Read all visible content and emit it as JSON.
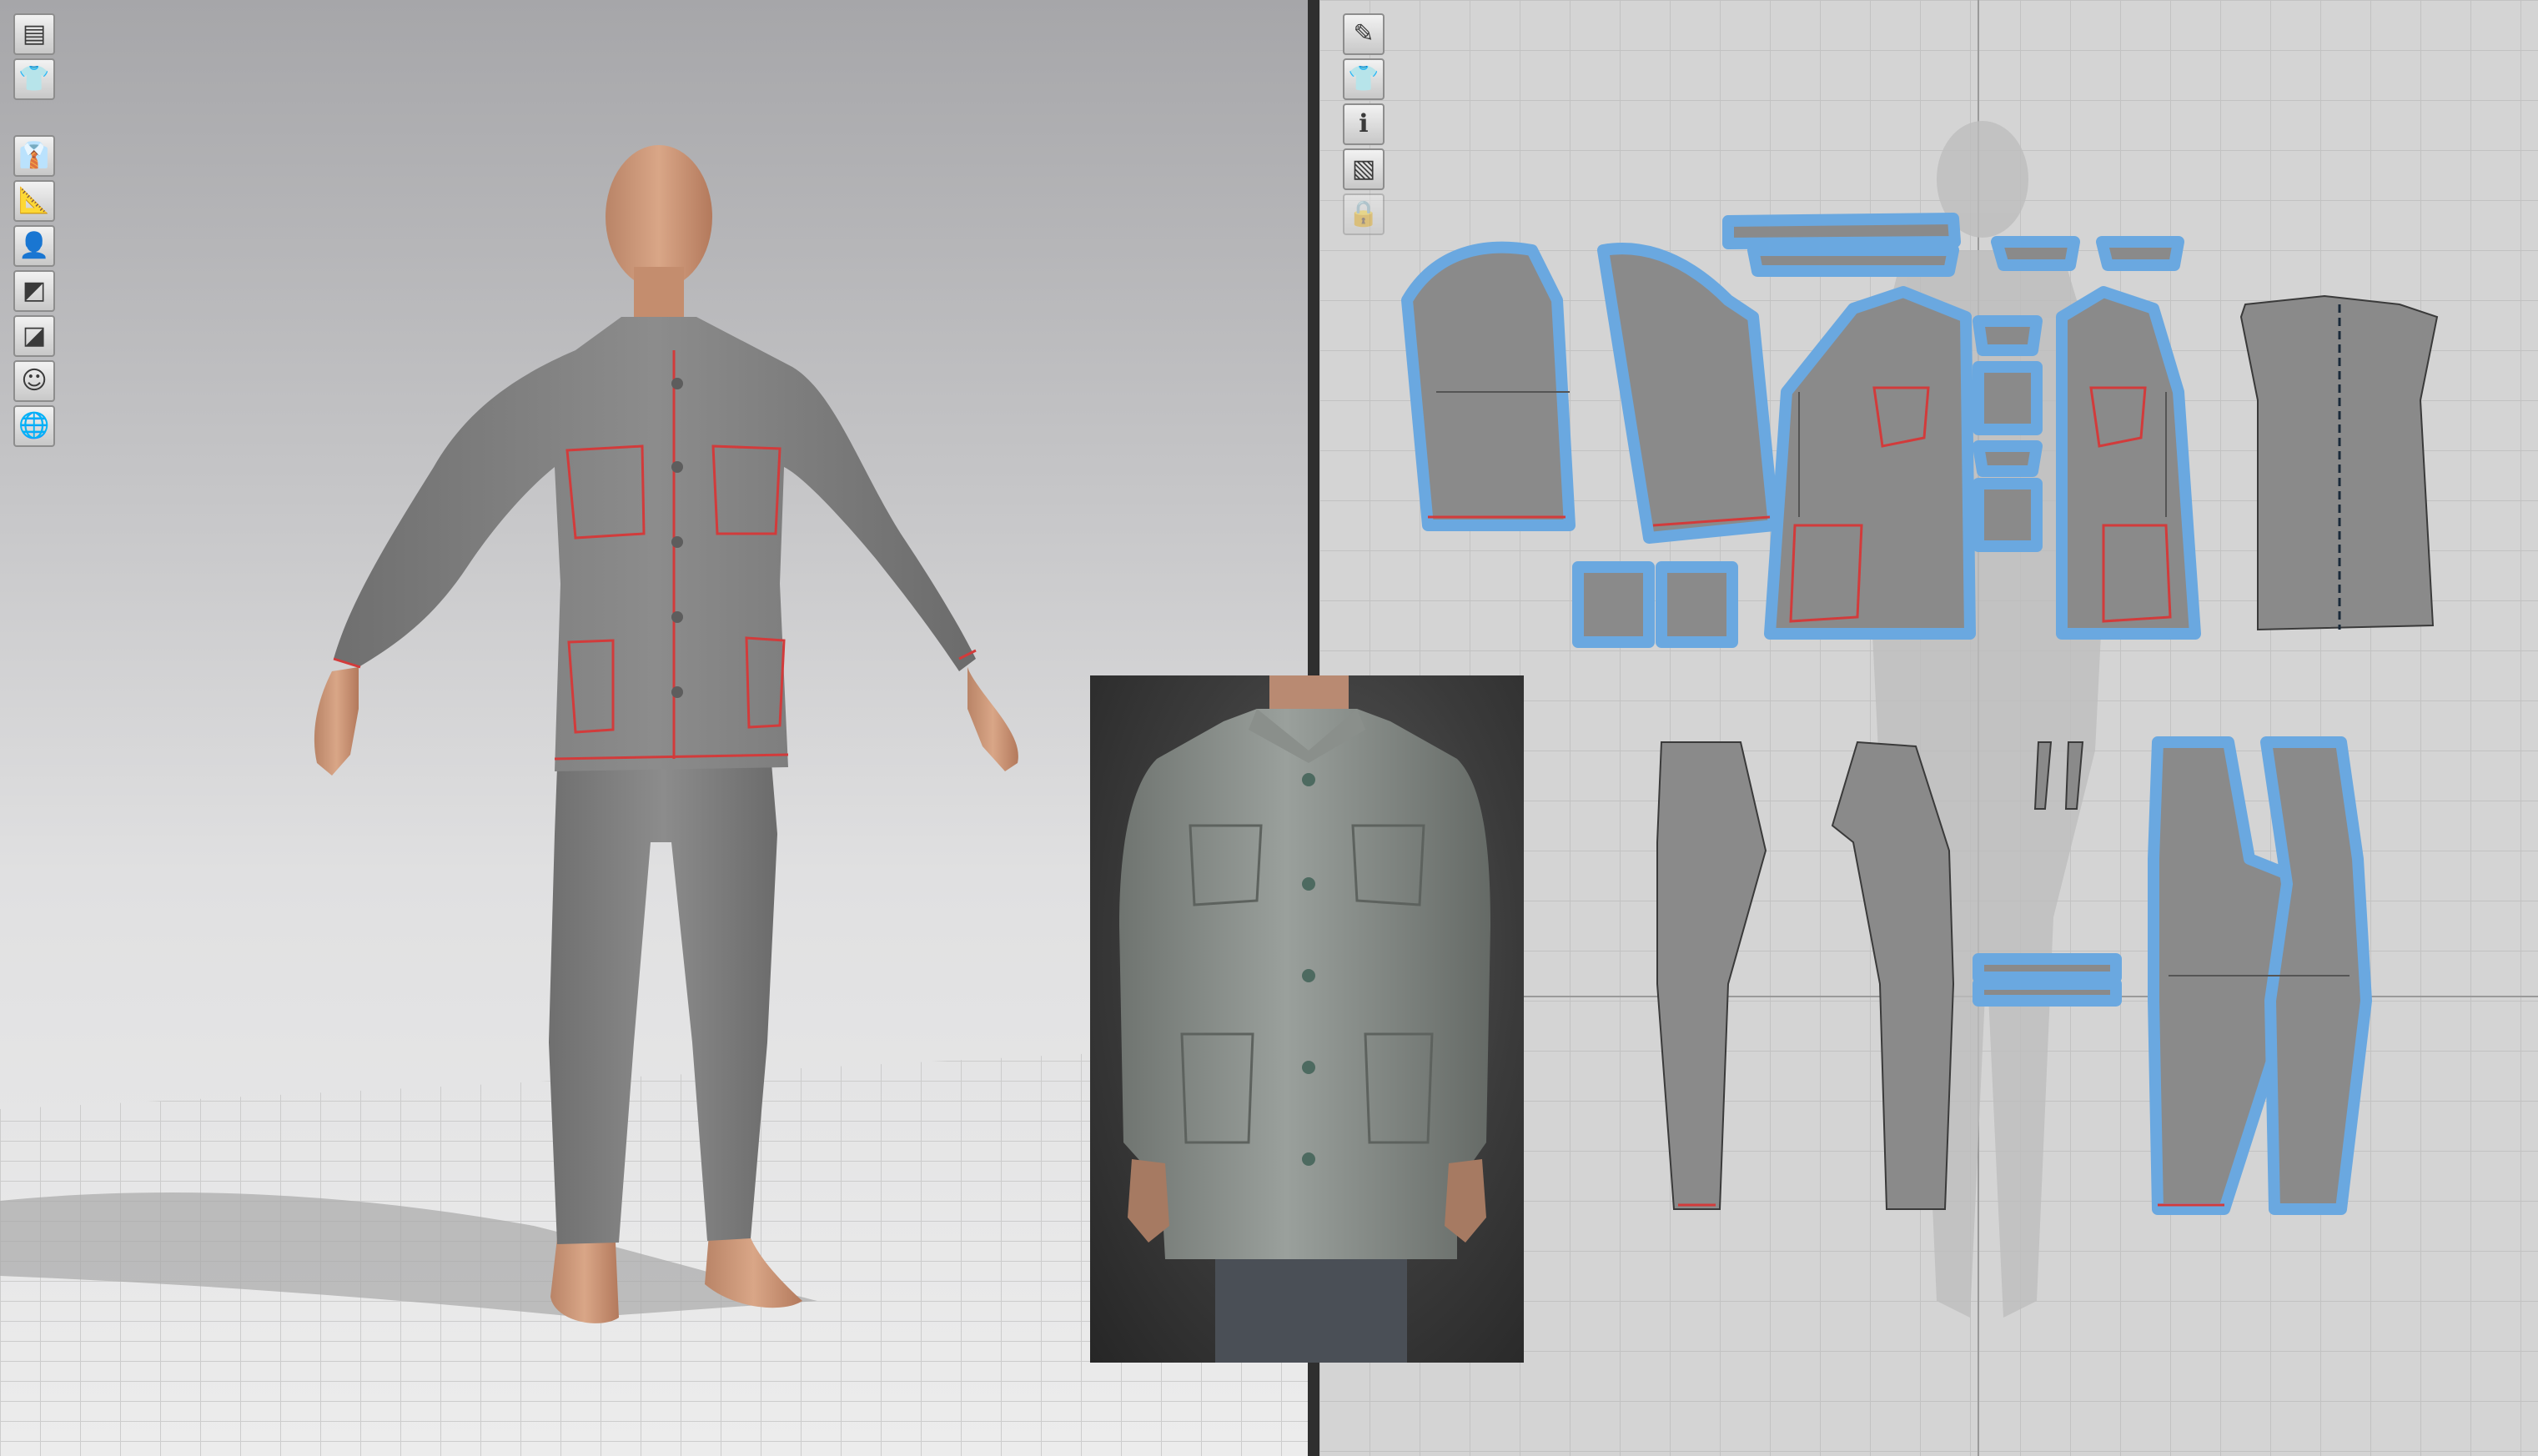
{
  "viewport3d": {
    "toolbar": [
      {
        "icon": "view-mode-icon"
      },
      {
        "icon": "show-garment-icon"
      },
      {
        "icon": "garment-texture-icon"
      },
      {
        "icon": "show-avatar-measure-icon"
      },
      {
        "icon": "show-avatar-icon"
      },
      {
        "icon": "fabric-render-icon"
      },
      {
        "icon": "shaded-view-icon"
      },
      {
        "icon": "avatar-skin-icon"
      },
      {
        "icon": "environment-globe-icon"
      }
    ]
  },
  "viewport2d": {
    "toolbar": [
      {
        "icon": "edit-pattern-icon"
      },
      {
        "icon": "show-3d-garment-icon"
      },
      {
        "icon": "pattern-info-icon"
      },
      {
        "icon": "texture-view-icon"
      },
      {
        "icon": "lock-garment-icon"
      }
    ]
  },
  "colors": {
    "fabric": "#8a8a8a",
    "selection_outline": "#6aa8e0",
    "seam_line": "#d23b3b",
    "grid_line": "#c2c2c2",
    "divider": "#2f2f2f"
  }
}
